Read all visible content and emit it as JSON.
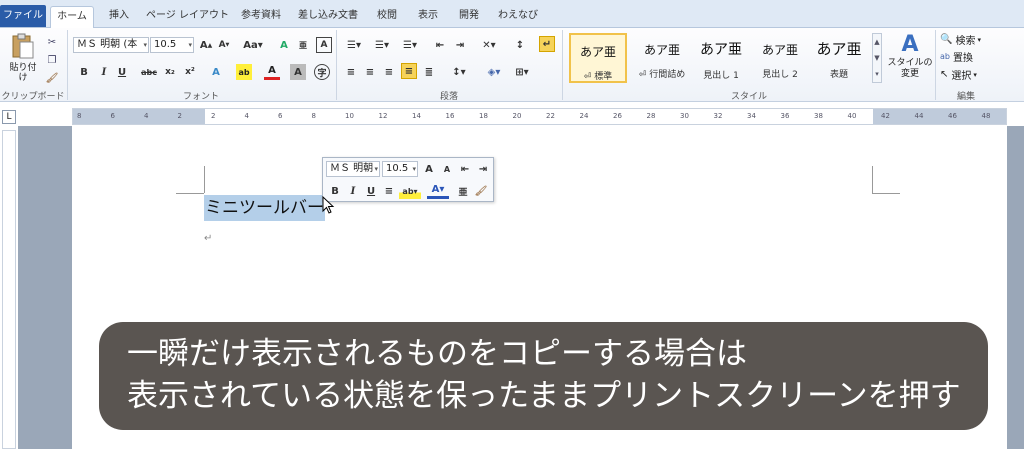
{
  "tabs": [
    {
      "label": "ファイル"
    },
    {
      "label": "ホーム"
    },
    {
      "label": "挿入"
    },
    {
      "label": "ページ レイアウト"
    },
    {
      "label": "参考資料"
    },
    {
      "label": "差し込み文書"
    },
    {
      "label": "校閲"
    },
    {
      "label": "表示"
    },
    {
      "label": "開発"
    },
    {
      "label": "わえなび"
    }
  ],
  "ribbon": {
    "clipboard": {
      "paste_label": "貼り付け",
      "group_label": "クリップボード"
    },
    "font": {
      "font_name": "ＭＳ 明朝 (本",
      "font_size": "10.5",
      "group_label": "フォント"
    },
    "paragraph": {
      "group_label": "段落"
    },
    "styles": {
      "items": [
        {
          "preview": "あア亜",
          "name": "⏎ 標準"
        },
        {
          "preview": "あア亜",
          "name": "⏎ 行間詰め"
        },
        {
          "preview": "あア亜",
          "name": "見出し 1"
        },
        {
          "preview": "あア亜",
          "name": "見出し 2"
        },
        {
          "preview": "あア亜",
          "name": "表題"
        }
      ],
      "change_label": "スタイルの変更",
      "group_label": "スタイル"
    },
    "editing": {
      "search": "検索",
      "replace": "置換",
      "select": "選択",
      "group_label": "編集"
    }
  },
  "ruler_ticks": [
    "8",
    "6",
    "4",
    "2",
    "2",
    "4",
    "6",
    "8",
    "10",
    "12",
    "14",
    "16",
    "18",
    "20",
    "22",
    "24",
    "26",
    "28",
    "30",
    "32",
    "34",
    "36",
    "38",
    "40",
    "42",
    "44",
    "46",
    "48"
  ],
  "document": {
    "selected_text": "ミニツールバー",
    "para_mark": "↵"
  },
  "mini_toolbar": {
    "font_name": "ＭＳ 明朝",
    "font_size": "10.5"
  },
  "caption": {
    "line1": "一瞬だけ表示されるものをコピーする場合は",
    "line2": "表示されている状態を保ったままプリントスクリーンを押す"
  },
  "colors": {
    "selection": "#b4cfe9",
    "file_tab": "#2a5ca8",
    "caption_bg": "#504a46"
  }
}
